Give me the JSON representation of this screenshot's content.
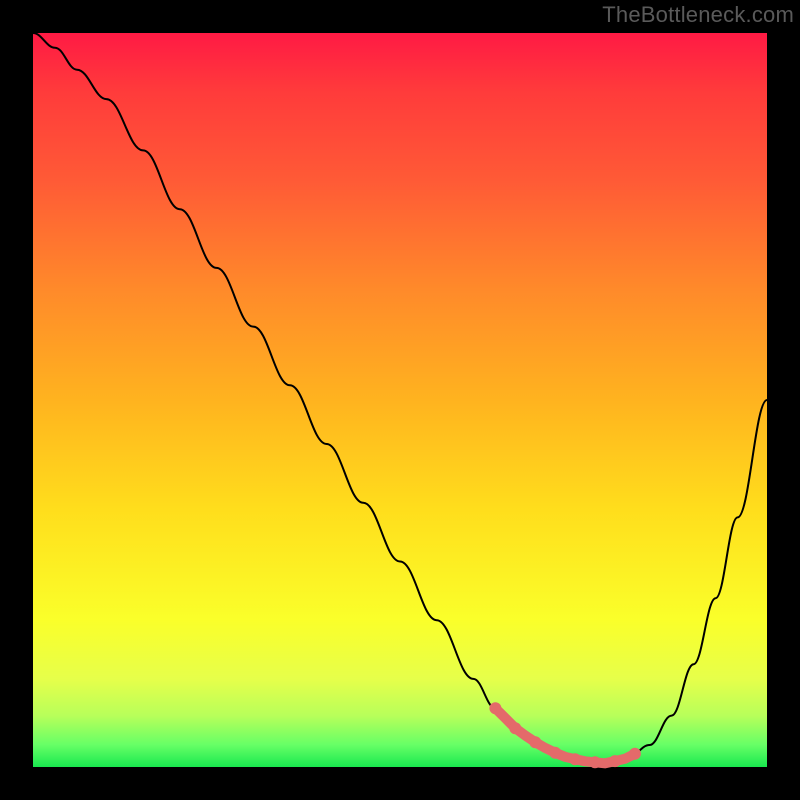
{
  "watermark": "TheBottleneck.com",
  "colors": {
    "background": "#000000",
    "curve": "#000000",
    "marker": "#e46a6a",
    "gradient_top": "#ff1a44",
    "gradient_bottom": "#19e84f"
  },
  "chart_data": {
    "type": "line",
    "title": "",
    "xlabel": "",
    "ylabel": "",
    "xlim": [
      0,
      100
    ],
    "ylim": [
      0,
      100
    ],
    "x": [
      0,
      3,
      6,
      10,
      15,
      20,
      25,
      30,
      35,
      40,
      45,
      50,
      55,
      60,
      63,
      66,
      69,
      72,
      75,
      78,
      81,
      84,
      87,
      90,
      93,
      96,
      100
    ],
    "values": [
      100,
      98,
      95,
      91,
      84,
      76,
      68,
      60,
      52,
      44,
      36,
      28,
      20,
      12,
      8,
      5,
      3,
      1.5,
      0.8,
      0.5,
      1.2,
      3,
      7,
      14,
      23,
      34,
      50
    ],
    "optimal_range_x": [
      63,
      82
    ],
    "annotations": []
  }
}
